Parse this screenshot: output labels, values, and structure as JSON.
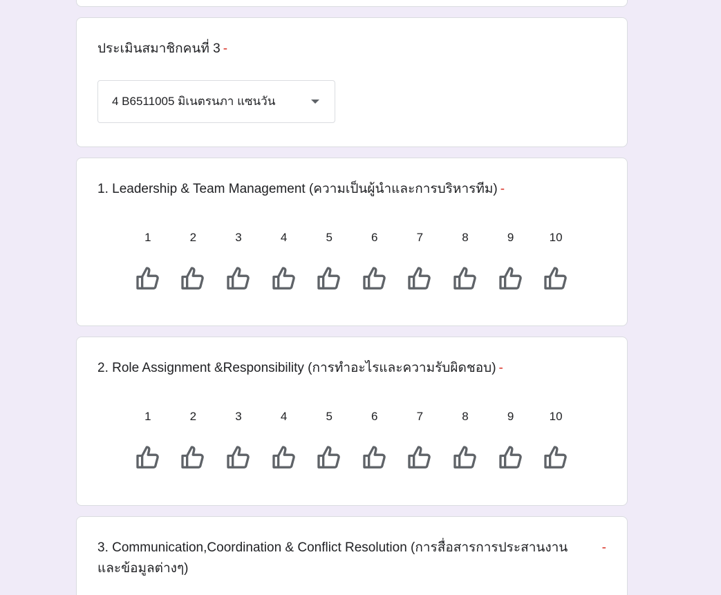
{
  "colors": {
    "background": "#f0ebf8",
    "card": "#ffffff",
    "required_marker": "#d93025",
    "thumb_icon": "#5f6368"
  },
  "required_marker": "-",
  "member_question": {
    "title": "ประเมินสมาชิกคนที่ 3",
    "selected_value": "4 B6511005 มิเนตรนภา แซนวัน"
  },
  "questions": [
    {
      "title": "1. Leadership & Team Management (ความเป็นผู้นำและการบริหารทีม)",
      "scale": [
        "1",
        "2",
        "3",
        "4",
        "5",
        "6",
        "7",
        "8",
        "9",
        "10"
      ],
      "icon": "thumb-up-icon"
    },
    {
      "title": "2. Role Assignment &Responsibility (การทำอะไรและความรับผิดชอบ)",
      "scale": [
        "1",
        "2",
        "3",
        "4",
        "5",
        "6",
        "7",
        "8",
        "9",
        "10"
      ],
      "icon": "thumb-up-icon"
    },
    {
      "title": "3. Communication,Coordination & Conflict Resolution (การสื่อสารการประสานงาน และข้อมูลต่างๆ)"
    }
  ]
}
